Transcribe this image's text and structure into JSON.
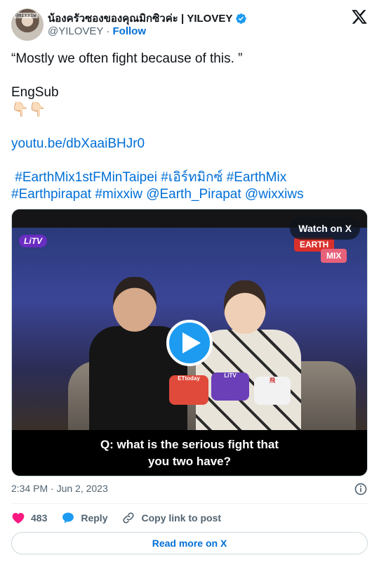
{
  "author": {
    "display_name": "น้องครัวซองของคุณมิกซิวค่ะ | YILOVEY",
    "handle": "@YILOVEY",
    "separator": "·",
    "follow_label": "Follow",
    "avatar_tag": "@mixxiw"
  },
  "tweet": {
    "line1": "“Mostly we often fight because of this. ”",
    "line2": "EngSub",
    "emoji": "👇🏻👇🏻",
    "link": "youtu.be/dbXaaiBHJr0",
    "hashtags_line1": " #EarthMix1stFMinTaipei #เอิร์ทมิกซ์ #EarthMix",
    "hashtags_line2": "#Earthpirapat #mixxiw @Earth_Pirapat @wixxiws"
  },
  "media": {
    "watch_label": "Watch on X",
    "channel_logo": "LiTV",
    "badge_earth": "EARTH",
    "badge_mix": "MIX",
    "mic1": "ETtoday",
    "mic2": "LiTV",
    "mic3": "飛",
    "subtitle_line1": "Q: what is the serious fight that",
    "subtitle_line2": "you two have?"
  },
  "meta": {
    "timestamp": "2:34 PM · Jun 2, 2023"
  },
  "actions": {
    "like_count": "483",
    "reply_label": "Reply",
    "copy_label": "Copy link to post"
  },
  "footer": {
    "read_more": "Read more on X"
  },
  "colors": {
    "link": "#006fd6",
    "like": "#f91880",
    "reply": "#1d9bf0",
    "verified": "#1d9bf0"
  }
}
